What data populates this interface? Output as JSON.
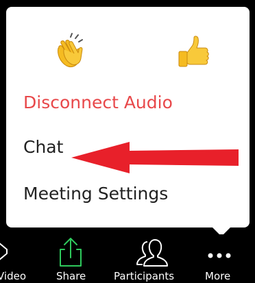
{
  "menu": {
    "reactions": [
      {
        "name": "clapping-hands",
        "glyph": "👏"
      },
      {
        "name": "thumbs-up",
        "glyph": "👍"
      }
    ],
    "items": [
      {
        "label": "Disconnect Audio",
        "color": "#e8484a"
      },
      {
        "label": "Chat",
        "color": "#222222"
      },
      {
        "label": "Meeting Settings",
        "color": "#222222"
      }
    ]
  },
  "toolbar": {
    "items": [
      {
        "label": "Video",
        "icon": "video-camera-icon"
      },
      {
        "label": "Share",
        "icon": "share-upload-icon",
        "color": "#2ec95c"
      },
      {
        "label": "Participants",
        "icon": "participants-icon"
      },
      {
        "label": "More",
        "icon": "more-dots-icon"
      }
    ]
  },
  "colors": {
    "accent_red": "#e8484a",
    "share_green": "#2ec95c",
    "annotation_arrow": "#e8202a",
    "emoji_yellow": "#f5bb21"
  }
}
